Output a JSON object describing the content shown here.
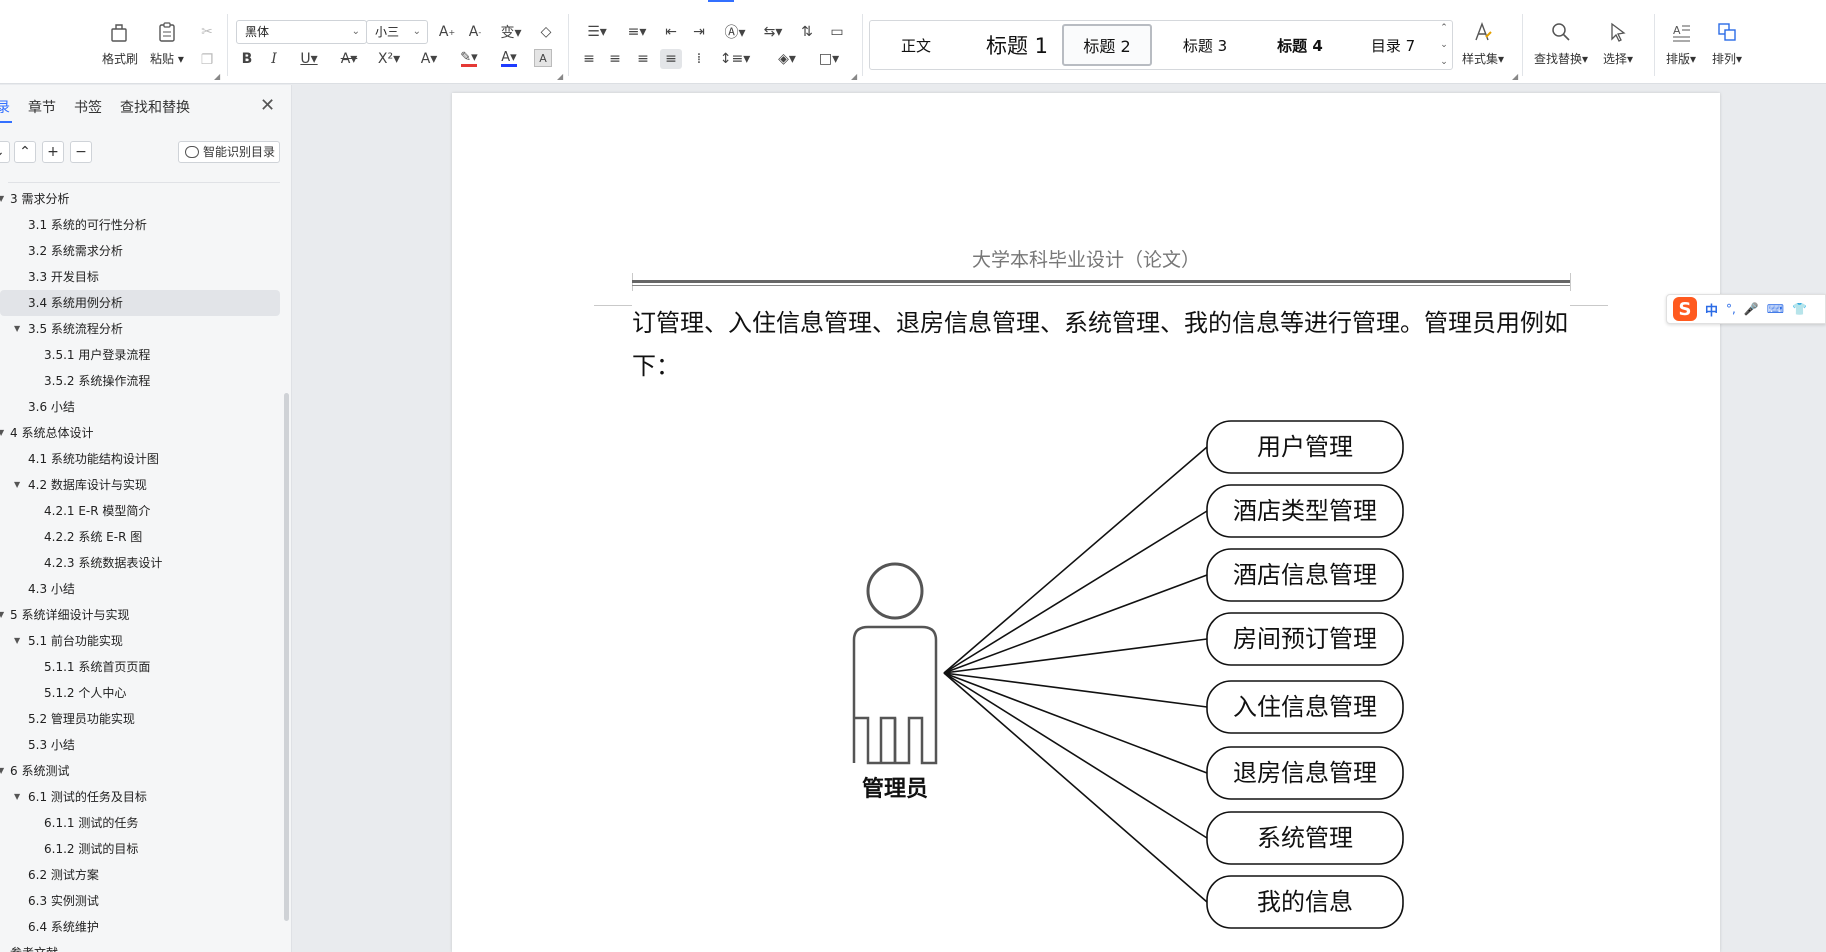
{
  "ribbon": {
    "clipboard": {
      "format_painter": "格式刷",
      "paste": "粘贴"
    },
    "font": {
      "family": "黑体",
      "size": "小三"
    },
    "styles": [
      "正文",
      "标题 1",
      "标题 2",
      "标题 3",
      "标题 4",
      "目录 7"
    ],
    "selected_style": "标题 2",
    "style_set": "样式集",
    "find_replace": "查找替换",
    "select": "选择",
    "layout": "排版",
    "arrange": "排列"
  },
  "colors": {
    "accent": "#3370ff",
    "font_red": "#e53935",
    "font_blue": "#1e3cff",
    "ime_orange": "#ff5a1f"
  },
  "nav": {
    "tabs": [
      "录",
      "章节",
      "书签",
      "查找和替换"
    ],
    "active_tab": "录",
    "smart_toc": "智能识别目录",
    "toc": [
      {
        "label": "3  需求分析",
        "level": 0,
        "expandable": true
      },
      {
        "label": "3.1 系统的可行性分析",
        "level": 1
      },
      {
        "label": "3.2 系统需求分析",
        "level": 1
      },
      {
        "label": "3.3 开发目标",
        "level": 1
      },
      {
        "label": "3.4  系统用例分析",
        "level": 1,
        "active": true
      },
      {
        "label": "3.5 系统流程分析",
        "level": 1,
        "expandable": true
      },
      {
        "label": "3.5.1  用户登录流程",
        "level": 2
      },
      {
        "label": "3.5.2  系统操作流程",
        "level": 2
      },
      {
        "label": "3.6 小结",
        "level": 1
      },
      {
        "label": "4  系统总体设计",
        "level": 0,
        "expandable": true
      },
      {
        "label": "4.1 系统功能结构设计图",
        "level": 1
      },
      {
        "label": "4.2  数据库设计与实现",
        "level": 1,
        "expandable": true
      },
      {
        "label": "4.2.1    E-R 模型简介",
        "level": 2
      },
      {
        "label": "4.2.2     系统 E-R 图",
        "level": 2
      },
      {
        "label": "4.2.3  系统数据表设计",
        "level": 2
      },
      {
        "label": "4.3 小结",
        "level": 1
      },
      {
        "label": "5  系统详细设计与实现",
        "level": 0,
        "expandable": true
      },
      {
        "label": "5.1 前台功能实现",
        "level": 1,
        "expandable": true
      },
      {
        "label": "5.1.1 系统首页页面",
        "level": 2
      },
      {
        "label": "5.1.2 个人中心",
        "level": 2
      },
      {
        "label": "5.2 管理员功能实现",
        "level": 1
      },
      {
        "label": "5.3  小结",
        "level": 1
      },
      {
        "label": "6  系统测试",
        "level": 0,
        "expandable": true
      },
      {
        "label": "6.1  测试的任务及目标",
        "level": 1,
        "expandable": true
      },
      {
        "label": "6.1.1    测试的任务",
        "level": 2
      },
      {
        "label": "6.1.2    测试的目标",
        "level": 2
      },
      {
        "label": "6.2    测试方案",
        "level": 1
      },
      {
        "label": "6.3    实例测试",
        "level": 1
      },
      {
        "label": "6.4    系统维护",
        "level": 1
      },
      {
        "label": "参考文献",
        "level": 0
      }
    ]
  },
  "document": {
    "header_text": "大学本科毕业设计（论文）",
    "paragraph": "订管理、入住信息管理、退房信息管理、系统管理、我的信息等进行管理。管理员用例如下：",
    "diagram": {
      "actor": "管理员",
      "use_cases": [
        "用户管理",
        "酒店类型管理",
        "酒店信息管理",
        "房间预订管理",
        "入住信息管理",
        "退房信息管理",
        "系统管理",
        "我的信息"
      ]
    }
  },
  "ime": {
    "mode": "中"
  }
}
